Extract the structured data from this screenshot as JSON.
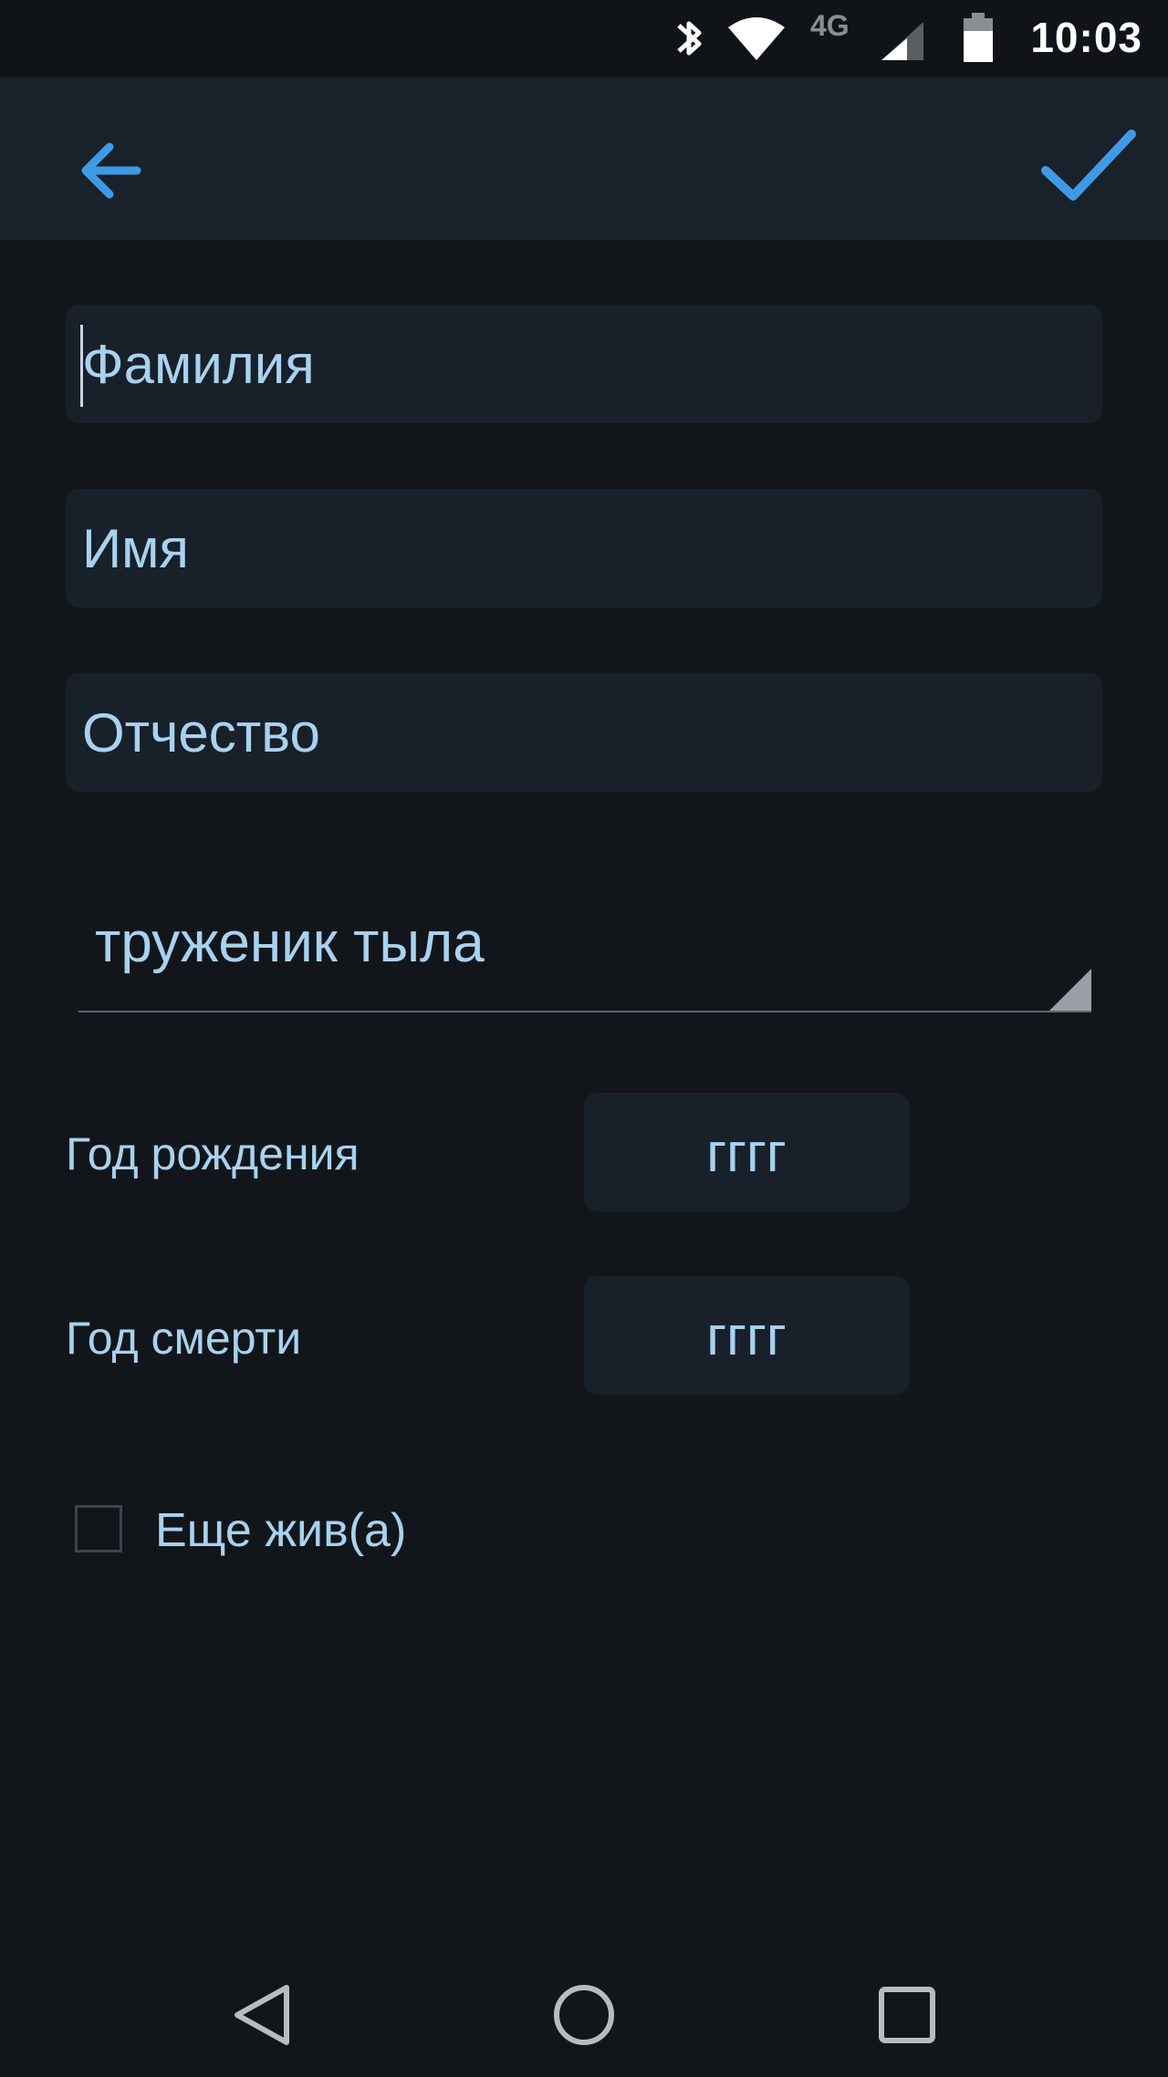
{
  "status_bar": {
    "time": "10:03",
    "network": "4G",
    "icons": [
      "bluetooth-icon",
      "wifi-icon",
      "signal-icon",
      "battery-icon"
    ]
  },
  "toolbar": {
    "back_icon": "arrow-left-icon",
    "done_icon": "checkmark-icon",
    "accent_color": "#3f9ae6"
  },
  "form": {
    "surname": {
      "value": "",
      "placeholder": "Фамилия"
    },
    "first_name": {
      "value": "",
      "placeholder": "Имя"
    },
    "patronymic": {
      "value": "",
      "placeholder": "Отчество"
    },
    "category": {
      "selected": "труженик тыла"
    },
    "birth_year": {
      "label": "Год рождения",
      "value": "",
      "placeholder": "гггг"
    },
    "death_year": {
      "label": "Год смерти",
      "value": "",
      "placeholder": "гггг"
    },
    "still_alive": {
      "label": "Еще жив(а)",
      "checked": false
    }
  },
  "nav_bar": {
    "icons": [
      "back-triangle-icon",
      "home-circle-icon",
      "recents-square-icon"
    ]
  },
  "colors": {
    "background": "#12161b",
    "toolbar": "#19212a",
    "field": "#18202a",
    "text": "#a8d2ee"
  }
}
